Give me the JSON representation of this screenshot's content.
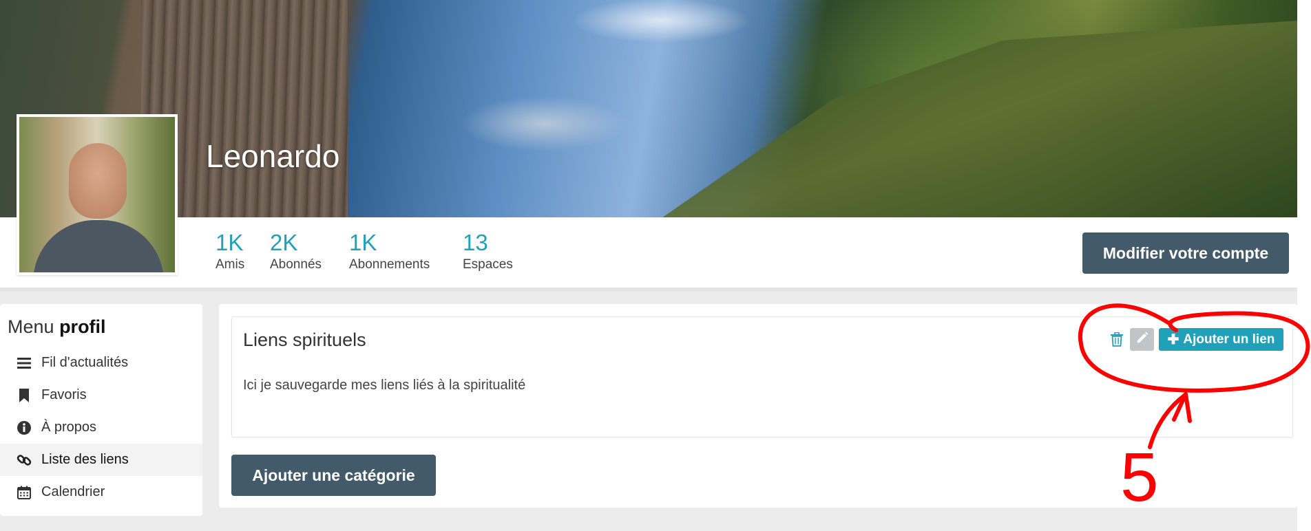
{
  "profile": {
    "name": "Leonardo",
    "stats": [
      {
        "value": "1K",
        "label": "Amis"
      },
      {
        "value": "2K",
        "label": "Abonnés"
      },
      {
        "value": "1K",
        "label": "Abonnements"
      },
      {
        "value": "13",
        "label": "Espaces"
      }
    ],
    "edit_account_label": "Modifier votre compte"
  },
  "sidebar": {
    "title_prefix": "Menu",
    "title_strong": "profil",
    "items": [
      {
        "label": "Fil d'actualités",
        "icon": "bars-icon",
        "active": false
      },
      {
        "label": "Favoris",
        "icon": "bookmark-icon",
        "active": false
      },
      {
        "label": "À propos",
        "icon": "info-icon",
        "active": false
      },
      {
        "label": "Liste des liens",
        "icon": "link-icon",
        "active": true
      },
      {
        "label": "Calendrier",
        "icon": "calendar-icon",
        "active": false
      }
    ]
  },
  "category": {
    "title": "Liens spirituels",
    "description": "Ici je sauvegarde mes liens liés à la spiritualité",
    "add_link_label": "Ajouter un lien"
  },
  "add_category_label": "Ajouter une catégorie",
  "annotation": {
    "number": "5",
    "color": "#ff0000"
  },
  "colors": {
    "accent": "#21a1b9",
    "dark_button": "#435a6a"
  }
}
